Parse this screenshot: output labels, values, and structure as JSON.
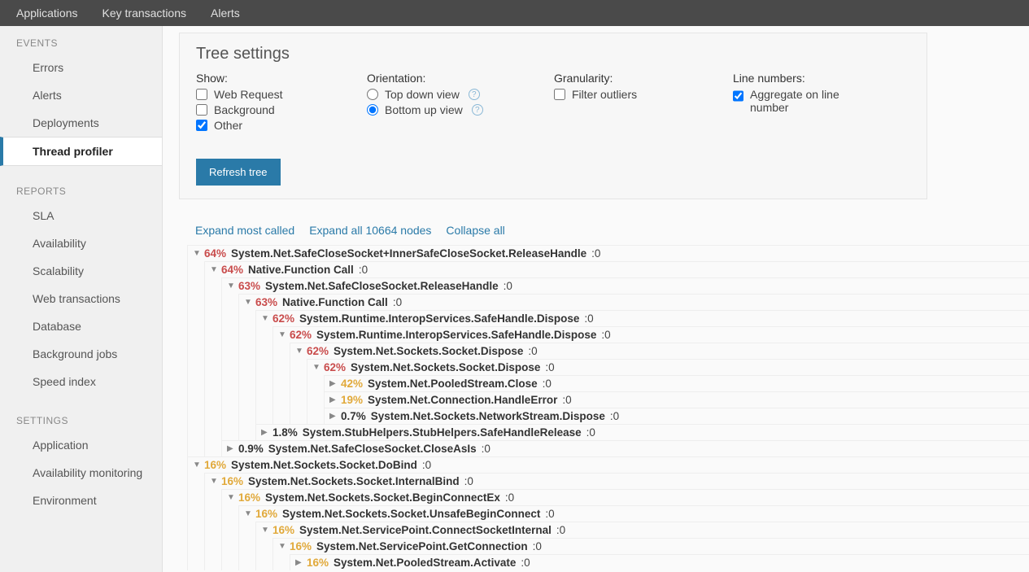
{
  "topnav": {
    "applications": "Applications",
    "key_transactions": "Key transactions",
    "alerts": "Alerts"
  },
  "sidebar": {
    "groups": [
      {
        "title": "EVENTS",
        "items": [
          {
            "label": "Errors",
            "active": false
          },
          {
            "label": "Alerts",
            "active": false
          },
          {
            "label": "Deployments",
            "active": false
          },
          {
            "label": "Thread profiler",
            "active": true
          }
        ]
      },
      {
        "title": "REPORTS",
        "items": [
          {
            "label": "SLA",
            "active": false
          },
          {
            "label": "Availability",
            "active": false
          },
          {
            "label": "Scalability",
            "active": false
          },
          {
            "label": "Web transactions",
            "active": false
          },
          {
            "label": "Database",
            "active": false
          },
          {
            "label": "Background jobs",
            "active": false
          },
          {
            "label": "Speed index",
            "active": false
          }
        ]
      },
      {
        "title": "SETTINGS",
        "items": [
          {
            "label": "Application",
            "active": false
          },
          {
            "label": "Availability monitoring",
            "active": false
          },
          {
            "label": "Environment",
            "active": false
          }
        ]
      }
    ]
  },
  "settings": {
    "title": "Tree settings",
    "show": {
      "label": "Show:",
      "web_request": "Web Request",
      "background": "Background",
      "other": "Other",
      "web_request_checked": false,
      "background_checked": false,
      "other_checked": true
    },
    "orientation": {
      "label": "Orientation:",
      "top_down": "Top down view",
      "bottom_up": "Bottom up view",
      "selected": "bottom_up"
    },
    "granularity": {
      "label": "Granularity:",
      "filter_outliers": "Filter outliers",
      "filter_outliers_checked": false
    },
    "line_numbers": {
      "label": "Line numbers:",
      "aggregate": "Aggregate on line number",
      "aggregate_checked": true
    },
    "refresh_label": "Refresh tree"
  },
  "tree_actions": {
    "expand_most": "Expand most called",
    "expand_all": "Expand all 10664 nodes",
    "collapse_all": "Collapse all"
  },
  "tree": [
    {
      "pct": "64%",
      "color": "red",
      "open": true,
      "method": "System.Net.SafeCloseSocket+InnerSafeCloseSocket.ReleaseHandle",
      "line": ":0",
      "children": [
        {
          "pct": "64%",
          "color": "red",
          "open": true,
          "method": "Native.Function Call",
          "line": ":0",
          "children": [
            {
              "pct": "63%",
              "color": "red",
              "open": true,
              "method": "System.Net.SafeCloseSocket.ReleaseHandle",
              "line": ":0",
              "children": [
                {
                  "pct": "63%",
                  "color": "red",
                  "open": true,
                  "method": "Native.Function Call",
                  "line": ":0",
                  "children": [
                    {
                      "pct": "62%",
                      "color": "red",
                      "open": true,
                      "method": "System.Runtime.InteropServices.SafeHandle.Dispose",
                      "line": ":0",
                      "children": [
                        {
                          "pct": "62%",
                          "color": "red",
                          "open": true,
                          "method": "System.Runtime.InteropServices.SafeHandle.Dispose",
                          "line": ":0",
                          "children": [
                            {
                              "pct": "62%",
                              "color": "red",
                              "open": true,
                              "method": "System.Net.Sockets.Socket.Dispose",
                              "line": ":0",
                              "children": [
                                {
                                  "pct": "62%",
                                  "color": "red",
                                  "open": true,
                                  "method": "System.Net.Sockets.Socket.Dispose",
                                  "line": ":0",
                                  "children": [
                                    {
                                      "pct": "42%",
                                      "color": "orange",
                                      "open": false,
                                      "method": "System.Net.PooledStream.Close",
                                      "line": ":0"
                                    },
                                    {
                                      "pct": "19%",
                                      "color": "orange",
                                      "open": false,
                                      "method": "System.Net.Connection.HandleError",
                                      "line": ":0"
                                    },
                                    {
                                      "pct": "0.7%",
                                      "color": "black",
                                      "open": false,
                                      "method": "System.Net.Sockets.NetworkStream.Dispose",
                                      "line": ":0"
                                    }
                                  ]
                                }
                              ]
                            }
                          ]
                        }
                      ]
                    },
                    {
                      "pct": "1.8%",
                      "color": "black",
                      "open": false,
                      "method": "System.StubHelpers.StubHelpers.SafeHandleRelease",
                      "line": ":0"
                    }
                  ]
                }
              ]
            },
            {
              "pct": "0.9%",
              "color": "black",
              "open": false,
              "method": "System.Net.SafeCloseSocket.CloseAsIs",
              "line": ":0"
            }
          ]
        }
      ]
    },
    {
      "pct": "16%",
      "color": "orange",
      "open": true,
      "method": "System.Net.Sockets.Socket.DoBind",
      "line": ":0",
      "children": [
        {
          "pct": "16%",
          "color": "orange",
          "open": true,
          "method": "System.Net.Sockets.Socket.InternalBind",
          "line": ":0",
          "children": [
            {
              "pct": "16%",
              "color": "orange",
              "open": true,
              "method": "System.Net.Sockets.Socket.BeginConnectEx",
              "line": ":0",
              "children": [
                {
                  "pct": "16%",
                  "color": "orange",
                  "open": true,
                  "method": "System.Net.Sockets.Socket.UnsafeBeginConnect",
                  "line": ":0",
                  "children": [
                    {
                      "pct": "16%",
                      "color": "orange",
                      "open": true,
                      "method": "System.Net.ServicePoint.ConnectSocketInternal",
                      "line": ":0",
                      "children": [
                        {
                          "pct": "16%",
                          "color": "orange",
                          "open": true,
                          "method": "System.Net.ServicePoint.GetConnection",
                          "line": ":0",
                          "children": [
                            {
                              "pct": "16%",
                              "color": "orange",
                              "open": false,
                              "method": "System.Net.PooledStream.Activate",
                              "line": ":0"
                            }
                          ]
                        }
                      ]
                    }
                  ]
                }
              ]
            }
          ]
        }
      ]
    }
  ]
}
